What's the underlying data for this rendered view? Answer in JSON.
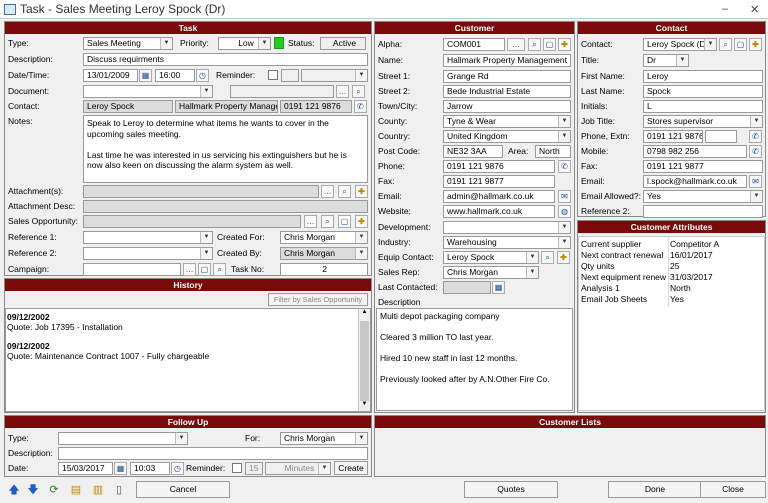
{
  "window": {
    "title": "Task - Sales Meeting Leroy Spock (Dr)",
    "minimize": "–",
    "close": "✕"
  },
  "task": {
    "header": "Task",
    "type_label": "Type:",
    "type_value": "Sales Meeting",
    "priority_label": "Priority:",
    "priority_value": "Low",
    "status_label": "Status:",
    "status_value": "Active",
    "description_label": "Description:",
    "description_value": "Discuss requirments",
    "datetime_label": "Date/Time:",
    "date_value": "13/01/2009",
    "time_value": "16:00",
    "reminder_label": "Reminder:",
    "document_label": "Document:",
    "contact_label": "Contact:",
    "contact_name": "Leroy Spock",
    "contact_job": "Hallmark Property Manager",
    "contact_phone": "0191 121 9876",
    "notes_label": "Notes:",
    "notes_value": "Speak to Leroy to determine what items he wants to cover in the upcoming sales meeting.\n\nLast time he was interested in us servicing his extinguishers but he is now also keen on discussing the alarm system as well.",
    "attachments_label": "Attachment(s):",
    "attachment_desc_label": "Attachment Desc:",
    "sales_opportunity_label": "Sales Opportunity:",
    "ref1_label": "Reference 1:",
    "ref2_label": "Reference 2:",
    "created_for_label": "Created For:",
    "created_for_value": "Chris Morgan",
    "created_by_label": "Created By:",
    "created_by_value": "Chris Morgan",
    "campaign_label": "Campaign:",
    "task_no_label": "Task No:",
    "task_no_value": "2"
  },
  "history": {
    "header": "History",
    "filter_button": "Filter by Sales Opportunity",
    "entries": [
      {
        "date": "09/12/2002",
        "text": "Quote: Job 17395 - Installation"
      },
      {
        "date": "09/12/2002",
        "text": "Quote: Maintenance Contract 1007 - Fully chargeable"
      }
    ]
  },
  "followup": {
    "header": "Follow Up",
    "type_label": "Type:",
    "for_label": "For:",
    "for_value": "Chris Morgan",
    "description_label": "Description:",
    "date_label": "Date:",
    "date_value": "15/03/2017",
    "time_value": "10:03",
    "reminder_label": "Reminder:",
    "reminder_qty": "15",
    "reminder_unit": "Minutes",
    "create_button": "Create"
  },
  "customer": {
    "header": "Customer",
    "alpha_label": "Alpha:",
    "alpha_value": "COM001",
    "name_label": "Name:",
    "name_value": "Hallmark Property Management Ltd",
    "street1_label": "Street 1:",
    "street1_value": "Grange Rd",
    "street2_label": "Street 2:",
    "street2_value": "Bede Industrial Estate",
    "town_label": "Town/City:",
    "town_value": "Jarrow",
    "county_label": "County:",
    "county_value": "Tyne & Wear",
    "country_label": "Country:",
    "country_value": "United Kingdom",
    "postcode_label": "Post Code:",
    "postcode_value": "NE32 3AA",
    "area_label": "Area:",
    "area_value": "North",
    "phone_label": "Phone:",
    "phone_value": "0191 121 9876",
    "fax_label": "Fax:",
    "fax_value": "0191 121 9877",
    "email_label": "Email:",
    "email_value": "admin@hallmark.co.uk",
    "website_label": "Website:",
    "website_value": "www.hallmark.co.uk",
    "development_label": "Development:",
    "industry_label": "Industry:",
    "industry_value": "Warehousing",
    "equip_contact_label": "Equip Contact:",
    "equip_contact_value": "Leroy Spock",
    "sales_rep_label": "Sales Rep:",
    "sales_rep_value": "Chris Morgan",
    "last_contacted_label": "Last Contacted:",
    "description_label": "Description",
    "description_value": "Multi depot packaging company\n\nCleared 3 million TO last year.\n\nHired 10 new staff in last 12 months.\n\nPreviously looked after by A.N.Other Fire Co."
  },
  "customer_lists": {
    "header": "Customer Lists"
  },
  "contact": {
    "header": "Contact",
    "contact_label": "Contact:",
    "contact_value": "Leroy Spock (Dr",
    "title_label": "Title:",
    "title_value": "Dr",
    "first_label": "First Name:",
    "first_value": "Leroy",
    "last_label": "Last Name:",
    "last_value": "Spock",
    "initials_label": "Initials:",
    "initials_value": "L",
    "job_label": "Job Title:",
    "job_value": "Stores supervisor",
    "phone_label": "Phone, Extn:",
    "phone_value": "0191 121 9876",
    "mobile_label": "Mobile:",
    "mobile_value": "0798 982 256",
    "fax_label": "Fax:",
    "fax_value": "0191 121 9877",
    "email_label": "Email:",
    "email_value": "l.spock@hallmark.co.uk",
    "email_allowed_label": "Email Allowed?:",
    "email_allowed_value": "Yes",
    "ref2_label": "Reference 2:"
  },
  "attributes": {
    "header": "Customer Attributes",
    "rows": [
      {
        "name": "Current supplier",
        "value": "Competitor A"
      },
      {
        "name": "Next contract renewal",
        "value": "16/01/2017"
      },
      {
        "name": "Qty units",
        "value": "25"
      },
      {
        "name": "Next equipment renew",
        "value": "31/03/2017"
      },
      {
        "name": "Analysis 1",
        "value": "North"
      },
      {
        "name": "Email Job Sheets",
        "value": "Yes"
      }
    ]
  },
  "footer": {
    "cancel": "Cancel",
    "quotes": "Quotes",
    "done": "Done",
    "close": "Close"
  },
  "colors": {
    "header_bg": "#7a0a0a",
    "status_green": "#22cc22"
  }
}
